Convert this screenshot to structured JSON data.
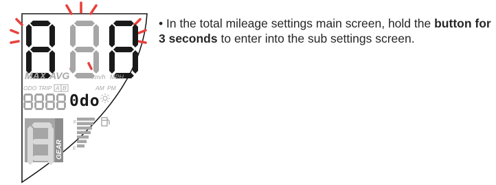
{
  "display": {
    "main_digits": [
      "8",
      "8",
      "8"
    ],
    "speed_modes": [
      "MAX",
      "AVG"
    ],
    "units": [
      "km/h",
      "MPH"
    ],
    "odometer_modes": [
      "ODO",
      "TRIP",
      "A",
      "B"
    ],
    "clock_labels": [
      "AM",
      "PM"
    ],
    "odometer_digits": [
      "8",
      "8",
      "8",
      "8"
    ],
    "sub_screen_text": "0do",
    "gear_label": "GEAR",
    "gear_digit": "8",
    "fuel_full_label": "F",
    "fuel_empty_label": "E",
    "flash_color": "#e8413c",
    "segment_on_color": "#1a1a1a",
    "segment_off_color": "#a6a6a6",
    "icons": [
      "sun-icon",
      "fuel-pump-icon"
    ]
  },
  "instruction": {
    "bullet": "•",
    "text_before": "In the total mileage settings main screen, hold the",
    "button_emphasis": "button for 3 seconds",
    "text_after": "to enter into the sub settings screen."
  }
}
